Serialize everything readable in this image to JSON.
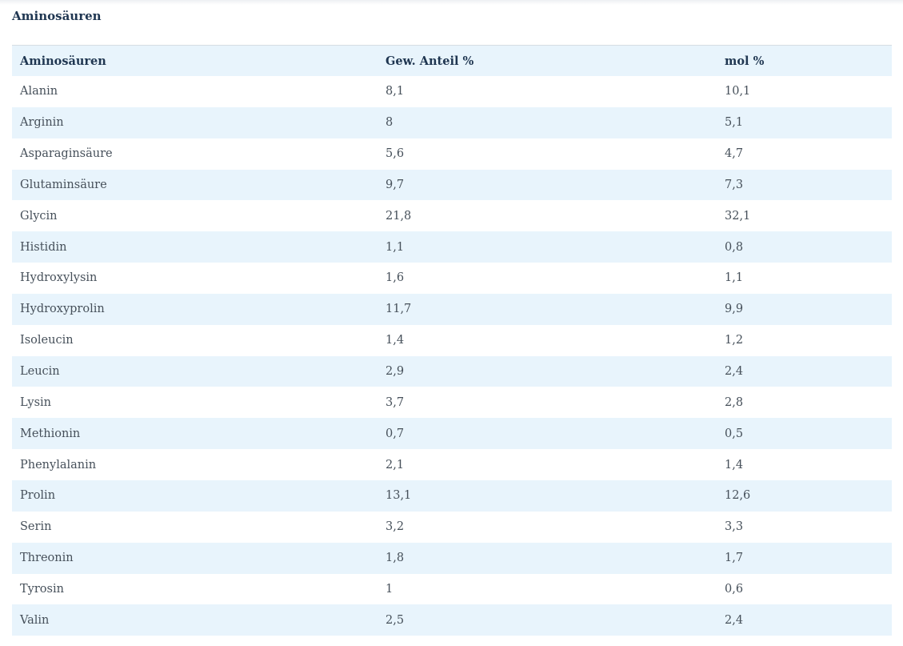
{
  "section": {
    "title": "Aminosäuren"
  },
  "table": {
    "headers": [
      "Aminosäuren",
      "Gew. Anteil %",
      "mol %"
    ],
    "rows": [
      [
        "Alanin",
        "8,1",
        "10,1"
      ],
      [
        "Arginin",
        "8",
        "5,1"
      ],
      [
        "Asparaginsäure",
        "5,6",
        "4,7"
      ],
      [
        "Glutaminsäure",
        "9,7",
        "7,3"
      ],
      [
        "Glycin",
        "21,8",
        "32,1"
      ],
      [
        "Histidin",
        "1,1",
        "0,8"
      ],
      [
        "Hydroxylysin",
        "1,6",
        "1,1"
      ],
      [
        "Hydroxyprolin",
        "11,7",
        "9,9"
      ],
      [
        "Isoleucin",
        "1,4",
        "1,2"
      ],
      [
        "Leucin",
        "2,9",
        "2,4"
      ],
      [
        "Lysin",
        "3,7",
        "2,8"
      ],
      [
        "Methionin",
        "0,7",
        "0,5"
      ],
      [
        "Phenylalanin",
        "2,1",
        "1,4"
      ],
      [
        "Prolin",
        "13,1",
        "12,6"
      ],
      [
        "Serin",
        "3,2",
        "3,3"
      ],
      [
        "Threonin",
        "1,8",
        "1,7"
      ],
      [
        "Tyrosin",
        "1",
        "0,6"
      ],
      [
        "Valin",
        "2,5",
        "2,4"
      ]
    ]
  }
}
